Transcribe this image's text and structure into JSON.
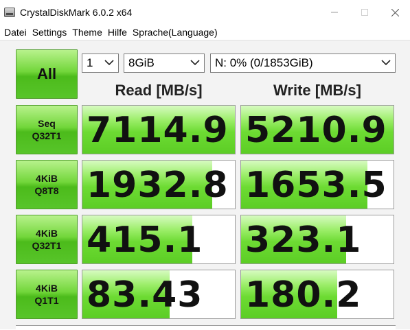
{
  "window": {
    "title": "CrystalDiskMark 6.0.2 x64"
  },
  "menu": {
    "items": [
      "Datei",
      "Settings",
      "Theme",
      "Hilfe",
      "Sprache(Language)"
    ]
  },
  "controls": {
    "all_label": "All",
    "count_value": "1",
    "size_value": "8GiB",
    "drive_value": "N: 0% (0/1853GiB)"
  },
  "headers": {
    "read": "Read [MB/s]",
    "write": "Write [MB/s]"
  },
  "tests": [
    {
      "line1": "Seq",
      "line2": "Q32T1",
      "read": "7114.9",
      "write": "5210.9",
      "read_fill_pct": 100,
      "write_fill_pct": 100
    },
    {
      "line1": "4KiB",
      "line2": "Q8T8",
      "read": "1932.8",
      "write": "1653.5",
      "read_fill_pct": 85,
      "write_fill_pct": 83
    },
    {
      "line1": "4KiB",
      "line2": "Q32T1",
      "read": "415.1",
      "write": "323.1",
      "read_fill_pct": 72,
      "write_fill_pct": 69
    },
    {
      "line1": "4KiB",
      "line2": "Q1T1",
      "read": "83.43",
      "write": "180.2",
      "read_fill_pct": 57,
      "write_fill_pct": 63
    }
  ],
  "colors": {
    "accent_green": "#5ccd25",
    "panel_bg": "#f3f3f3"
  }
}
